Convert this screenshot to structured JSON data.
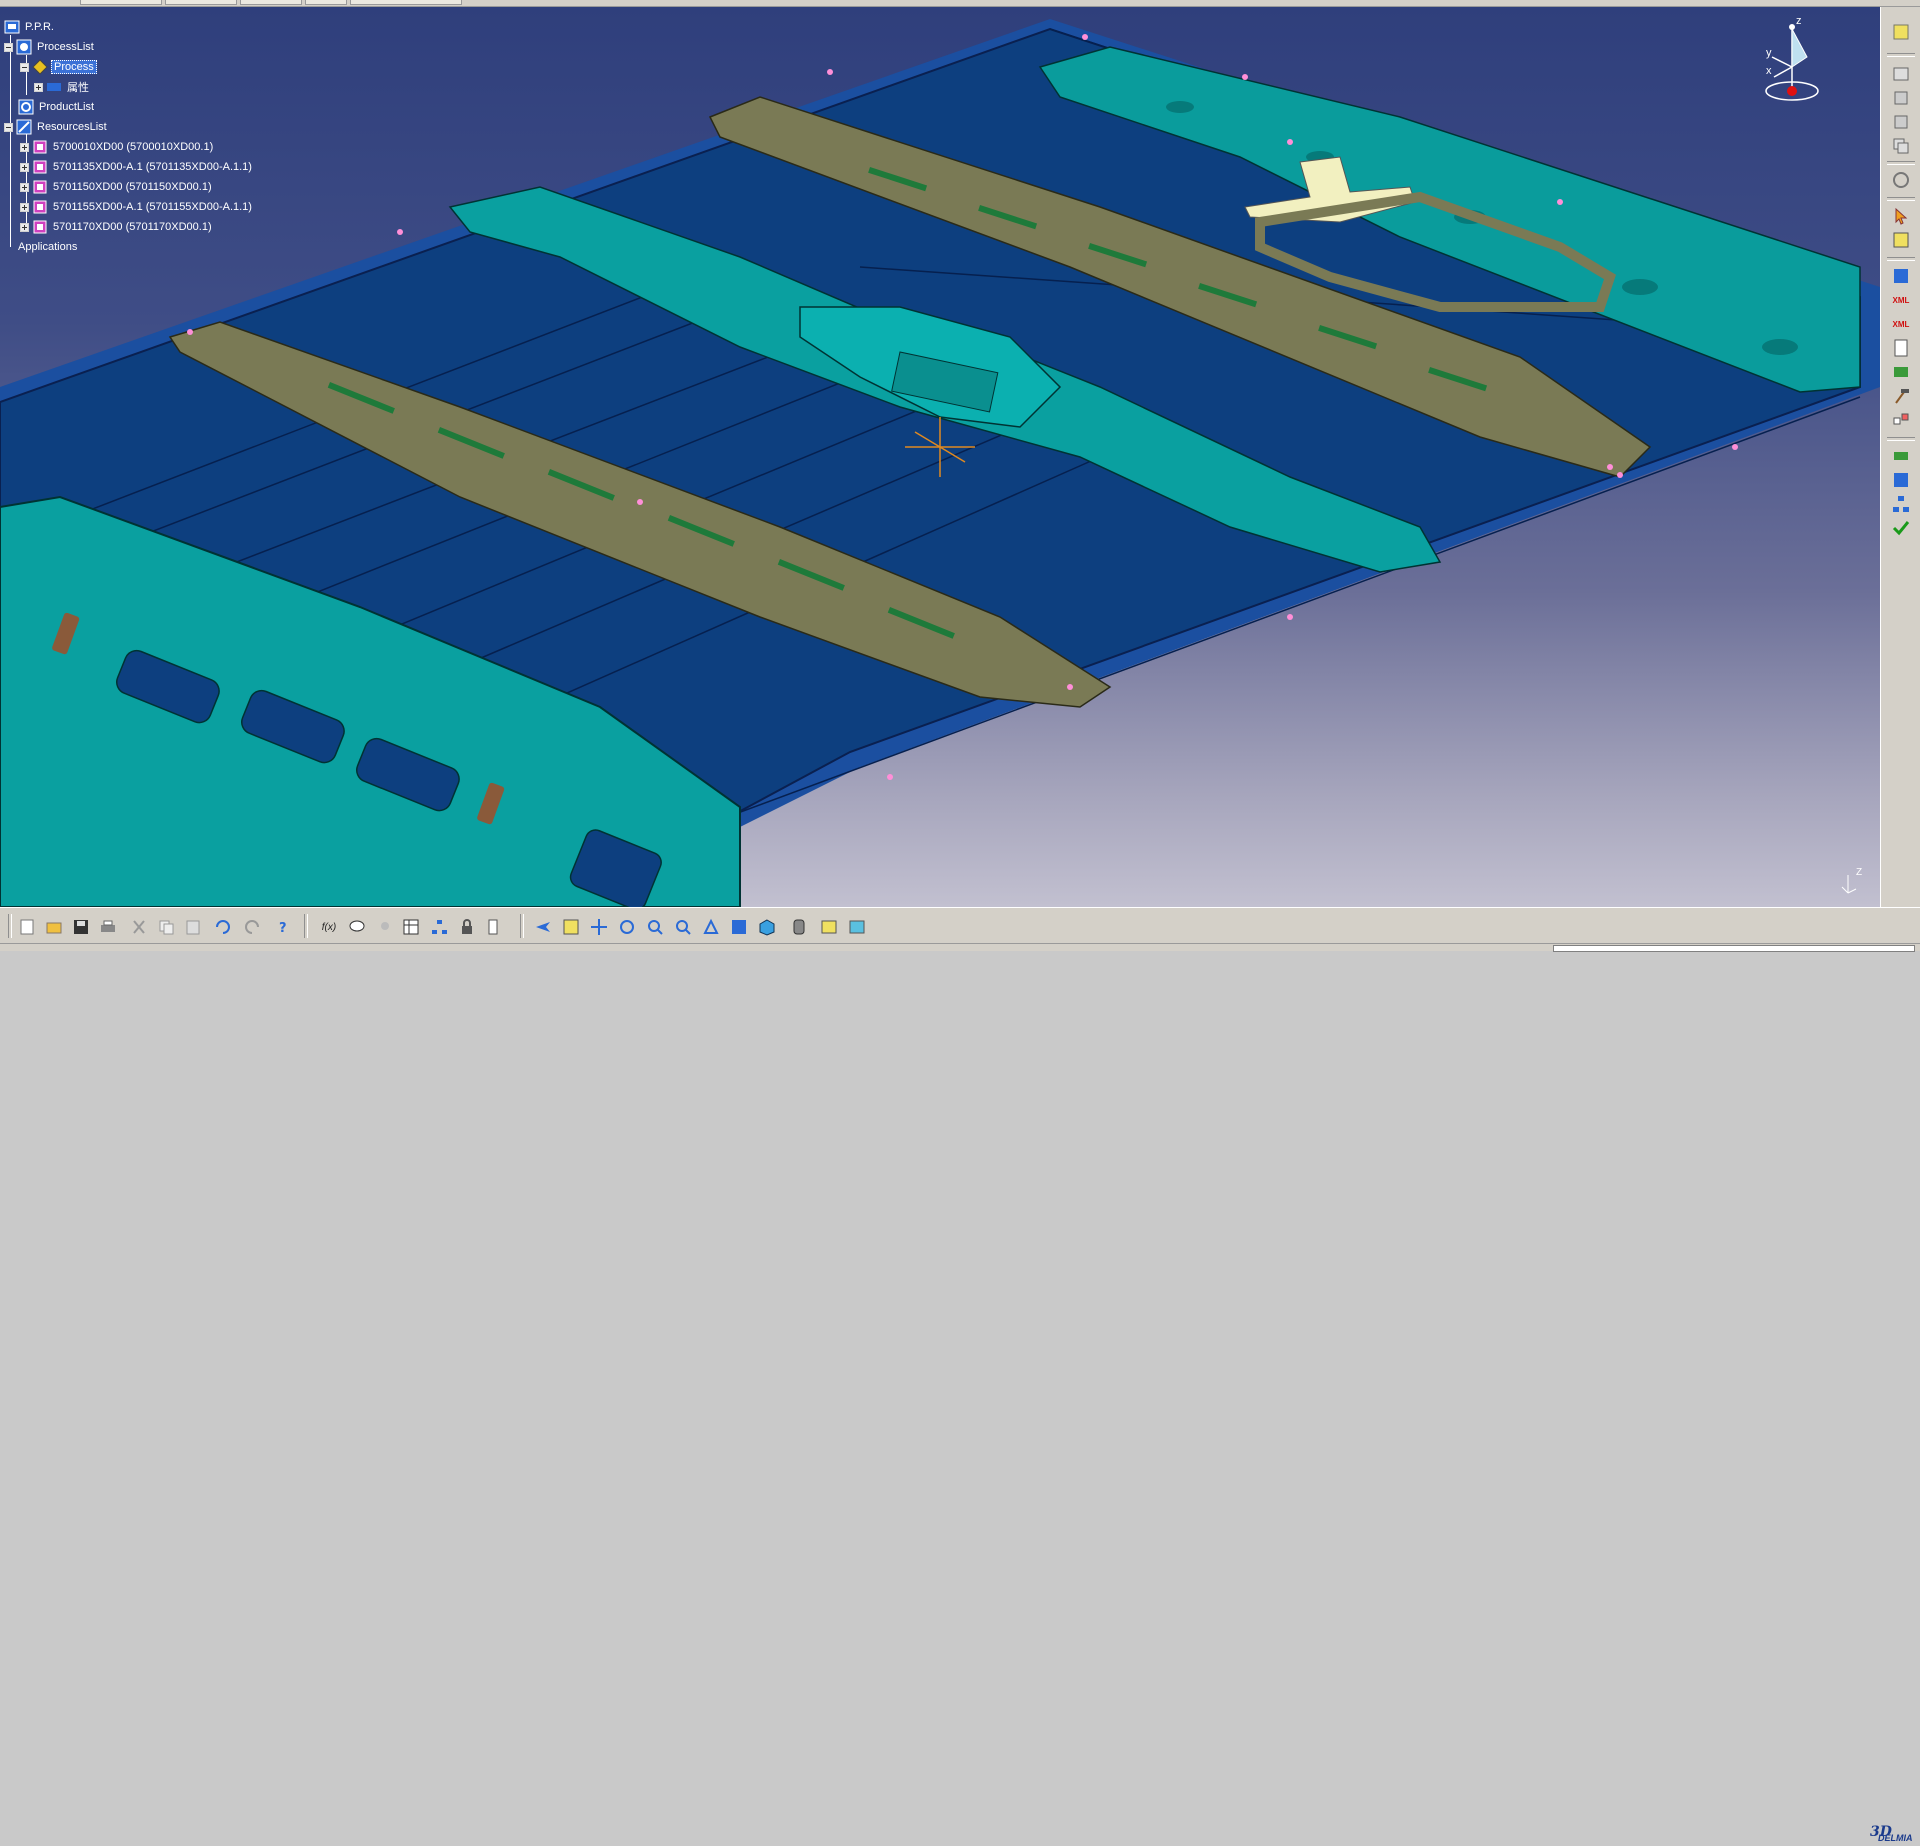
{
  "app": {
    "brand": "DELMIA",
    "brand_logo_text": "3DS"
  },
  "tree": {
    "root": "P.P.R.",
    "process_list": "ProcessList",
    "process": "Process",
    "attributes": "属性",
    "product_list": "ProductList",
    "resources_list": "ResourcesList",
    "resources": [
      "5700010XD00 (5700010XD00.1)",
      "5701135XD00-A.1 (5701135XD00-A.1.1)",
      "5701150XD00 (5701150XD00.1)",
      "5701155XD00-A.1 (5701155XD00-A.1.1)",
      "5701170XD00 (5701170XD00.1)"
    ],
    "applications": "Applications"
  },
  "compass": {
    "z": "z",
    "y": "y",
    "x": "x"
  },
  "mini_axis": {
    "z": "Z"
  },
  "right_toolbar": {
    "icons": [
      "sticky-note-icon",
      "window-icon",
      "assembly-icon",
      "assembly-alt-icon",
      "copy-icon",
      "compass-wheel-icon",
      "select-arrow-icon",
      "fit-select-icon",
      "xml-export-icon",
      "xml-icon",
      "xml-alt-icon",
      "report-icon",
      "process-flow-icon",
      "hammer-icon",
      "swap-icon",
      "link-icon",
      "list-icon",
      "hierarchy-icon",
      "check-icon"
    ],
    "xml_label": "XML"
  },
  "bottom_toolbar": {
    "icons": [
      "new-file-icon",
      "open-folder-icon",
      "save-icon",
      "print-icon",
      "cut-icon",
      "copy-icon",
      "paste-icon",
      "undo-icon",
      "redo-icon",
      "whats-this-icon",
      "formula-icon",
      "comment-icon",
      "light-icon",
      "table-icon",
      "tree-graph-icon",
      "lock-icon",
      "catalog-icon",
      "fly-mode-icon",
      "fit-all-icon",
      "pan-icon",
      "rotate-icon",
      "zoom-in-icon",
      "zoom-out-icon",
      "normal-view-icon",
      "multi-view-icon",
      "iso-view-icon",
      "render-style-icon",
      "hide-show-icon",
      "swap-space-icon"
    ],
    "formula_label": "f(x)"
  },
  "colors": {
    "viewport_top": "#2f3f7c",
    "roof_panel": "#0d3f7f",
    "teal_part": "#0a9c9c",
    "olive_part": "#7a7a55",
    "selected_bg": "#3b71d6",
    "toolbar_bg": "#d4d0c8"
  }
}
